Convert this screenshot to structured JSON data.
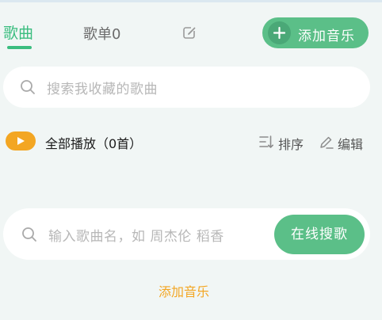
{
  "tabs": {
    "songs_label": "歌曲",
    "playlists_label": "歌单0"
  },
  "header": {
    "add_music_label": "添加音乐"
  },
  "search": {
    "placeholder": "搜索我收藏的歌曲"
  },
  "playbar": {
    "play_all_label": "全部播放（0首）",
    "sort_label": "排序",
    "edit_label": "编辑"
  },
  "online_search": {
    "placeholder": "输入歌曲名，如 周杰伦 稻香",
    "button_label": "在线搜歌"
  },
  "empty": {
    "add_music_link": "添加音乐"
  },
  "colors": {
    "accent_green": "#5bbf88",
    "accent_orange": "#f3a623",
    "background": "#f1f6f5"
  }
}
